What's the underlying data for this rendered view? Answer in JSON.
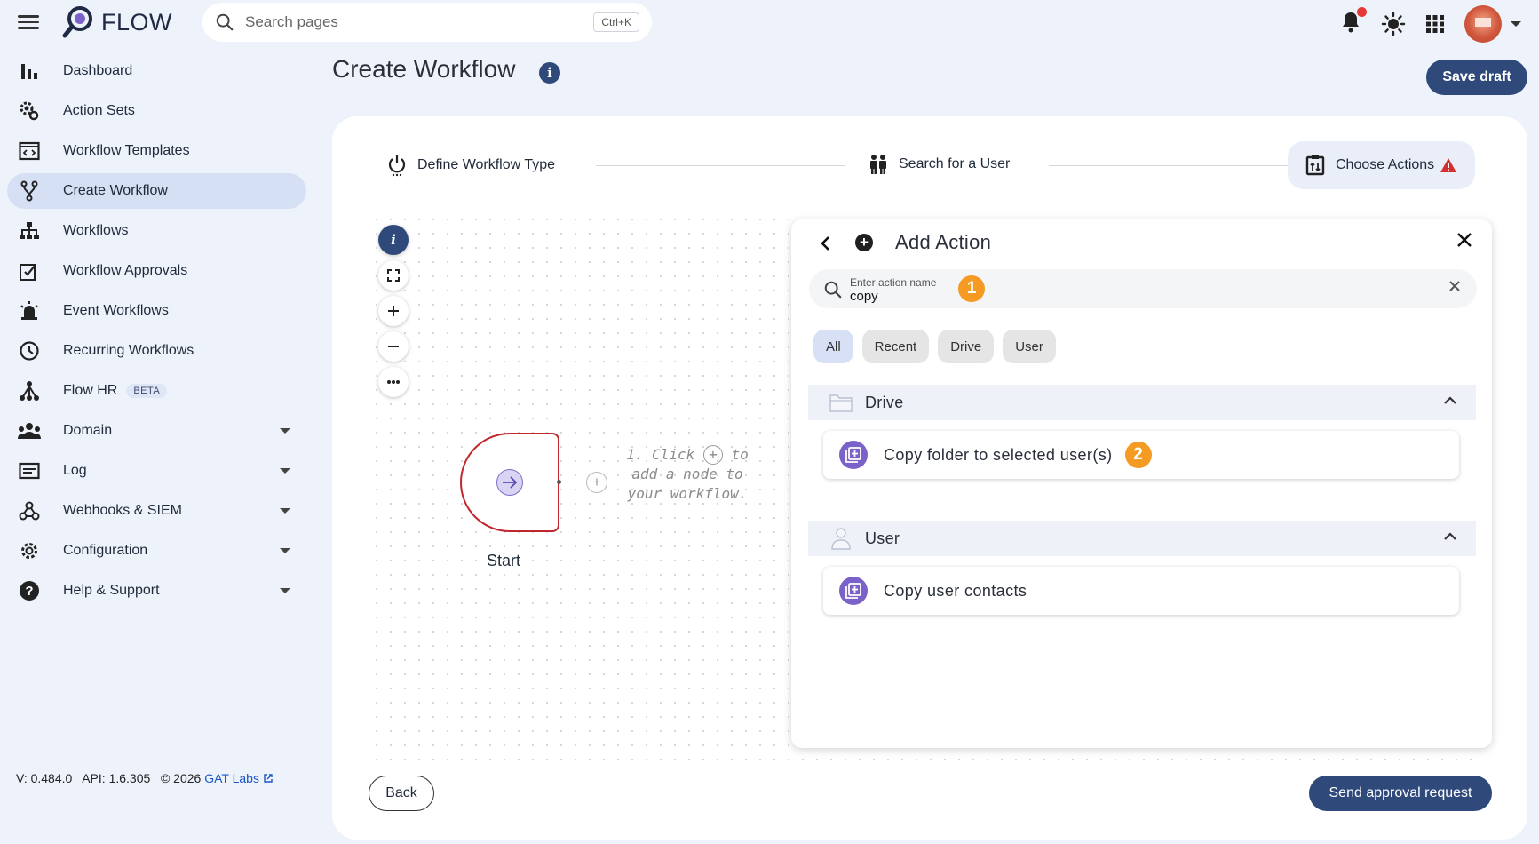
{
  "app": {
    "name": "FLOW"
  },
  "search": {
    "placeholder": "Search pages",
    "shortcut": "Ctrl+K"
  },
  "sidebar": {
    "items": [
      {
        "label": "Dashboard",
        "icon": "bar-chart-icon"
      },
      {
        "label": "Action Sets",
        "icon": "gears-icon"
      },
      {
        "label": "Workflow Templates",
        "icon": "template-icon"
      },
      {
        "label": "Create Workflow",
        "icon": "fork-icon",
        "active": true
      },
      {
        "label": "Workflows",
        "icon": "sitemap-icon"
      },
      {
        "label": "Workflow Approvals",
        "icon": "approval-icon"
      },
      {
        "label": "Event Workflows",
        "icon": "alarm-light-icon"
      },
      {
        "label": "Recurring Workflows",
        "icon": "clock-icon"
      },
      {
        "label": "Flow HR",
        "icon": "hierarchy-icon",
        "badge": "BETA"
      },
      {
        "label": "Domain",
        "icon": "group-icon",
        "expandable": true
      },
      {
        "label": "Log",
        "icon": "log-icon",
        "expandable": true
      },
      {
        "label": "Webhooks & SIEM",
        "icon": "webhook-icon",
        "expandable": true
      },
      {
        "label": "Configuration",
        "icon": "gear-icon",
        "expandable": true
      },
      {
        "label": "Help & Support",
        "icon": "help-icon",
        "expandable": true
      }
    ]
  },
  "footer": {
    "version": "V: 0.484.0",
    "api": "API: 1.6.305",
    "copyright": "© 2026",
    "company": "GAT Labs"
  },
  "page": {
    "title": "Create Workflow",
    "save_draft": "Save draft"
  },
  "stepper": {
    "steps": [
      {
        "label": "Define Workflow Type"
      },
      {
        "label": "Search for a User"
      },
      {
        "label": "Choose Actions",
        "active": true,
        "warning": true
      }
    ]
  },
  "canvas": {
    "start_label": "Start",
    "hint_line1": "1. Click",
    "hint_line1b": "to",
    "hint_line2": "add a node to",
    "hint_line3": "your workflow.",
    "plus_symbol": "+"
  },
  "panel": {
    "title": "Add Action",
    "search_label": "Enter action name",
    "search_value": "copy",
    "step1": "1",
    "step2": "2",
    "filters": [
      "All",
      "Recent",
      "Drive",
      "User"
    ],
    "groups": [
      {
        "label": "Drive",
        "items": [
          "Copy folder to selected user(s)"
        ]
      },
      {
        "label": "User",
        "items": [
          "Copy user contacts"
        ]
      }
    ]
  },
  "buttons": {
    "back": "Back",
    "send": "Send approval request"
  },
  "colors": {
    "primary": "#2f4a7a",
    "accent_orange": "#f59a23",
    "action_purple": "#7b62c9",
    "node_red": "#c0282d"
  }
}
